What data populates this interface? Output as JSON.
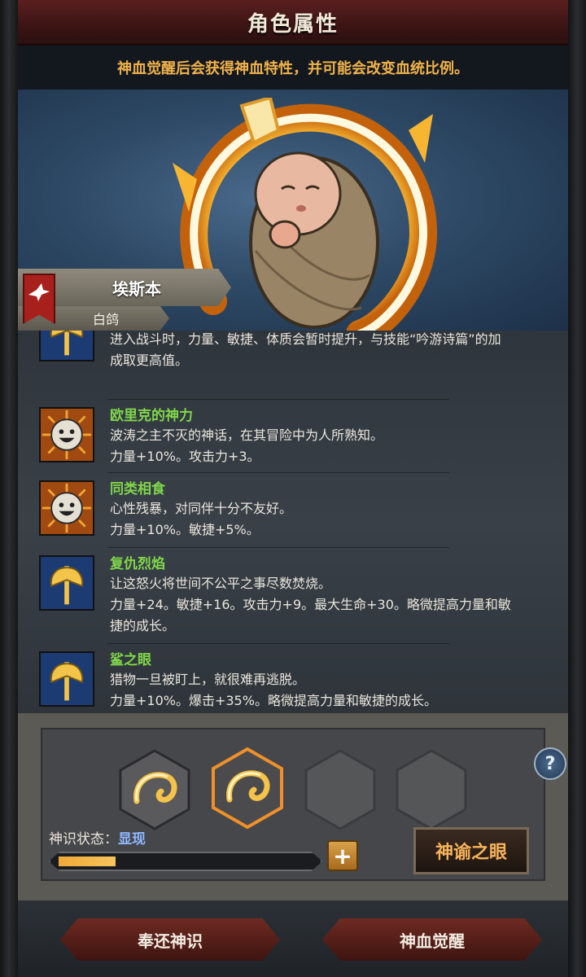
{
  "header": {
    "title": "角色属性"
  },
  "notice": "神血觉醒后会获得神血特性，并可能会改变血统比例。",
  "character": {
    "name": "埃斯本",
    "subtitle": "白鸽"
  },
  "traits": [
    {
      "name": "",
      "desc": "进入战斗时，力量、敏捷、体质会暂时提升，与技能“吟游诗篇”的加",
      "effect": "成取更高值。",
      "icon": "axe-icon"
    },
    {
      "name": "欧里克的神力",
      "desc": "波涛之主不灭的神话，在其冒险中为人所熟知。",
      "effect": "力量+10%。攻击力+3。",
      "icon": "sun-face-icon"
    },
    {
      "name": "同类相食",
      "desc": "心性残暴，对同伴十分不友好。",
      "effect": "力量+10%。敏捷+5%。",
      "icon": "sun-face-icon"
    },
    {
      "name": "复仇烈焰",
      "desc": "让这怒火将世间不公平之事尽数焚烧。",
      "effect": "力量+24。敏捷+16。攻击力+9。最大生命+30。略微提高力量和敏",
      "effect2": "捷的成长。",
      "icon": "axe-icon"
    },
    {
      "name": "鲨之眼",
      "desc": "猎物一旦被盯上，就很难再逃脱。",
      "effect": "力量+10%。爆击+35%。略微提高力量和敏捷的成长。",
      "icon": "axe-icon"
    }
  ],
  "awakening": {
    "status_label": "神识状态：",
    "status_value": "显现",
    "progress": 0.22,
    "oracle_button": "神谕之眼",
    "help": "?"
  },
  "footer": {
    "left_button": "奉还神识",
    "right_button": "神血觉醒"
  }
}
